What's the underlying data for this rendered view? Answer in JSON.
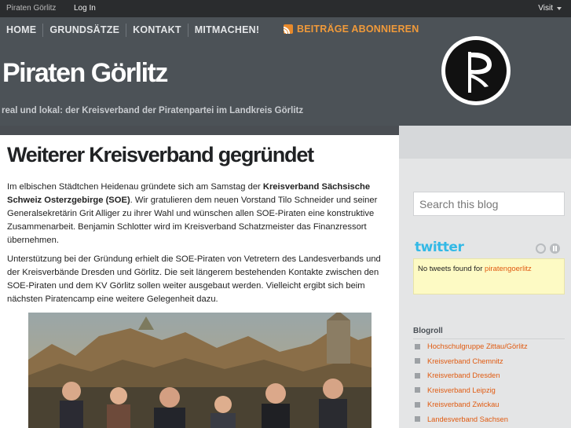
{
  "adminbar": {
    "site_name": "Piraten Görlitz",
    "login": "Log In",
    "visit": "Visit"
  },
  "nav": {
    "items": [
      "HOME",
      "GRUNDSÄTZE",
      "KONTAKT",
      "MITMACHEN!"
    ],
    "feed_label": "BEITRÄGE ABONNIEREN"
  },
  "header": {
    "title": "Piraten Görlitz",
    "tagline": "real und lokal: der Kreisverband der Piratenpartei im Landkreis Görlitz"
  },
  "post": {
    "title": "Weiterer Kreisverband gegründet",
    "p1_a": "Im elbischen Städtchen Heidenau gründete sich am Samstag der ",
    "p1_b": "Kreisverband Sächsische Schweiz Osterzgebirge (SOE)",
    "p1_c": ". Wir gratulieren dem neuen Vorstand Tilo Schneider und seiner Generalsekretärin Grit Alliger zu ihrer Wahl und wünschen allen SOE-Piraten eine konstruktive Zusammenarbeit. Benjamin Schlotter wird im Kreisverband Schatzmeister das Finanzressort übernehmen.",
    "p2": "Unterstützung bei der Gründung erhielt die SOE-Piraten von Vetretern des Landesverbands und der Kreisverbände Dresden und Görlitz. Die seit längerem bestehenden Kontakte zwischen den SOE-Piraten und dem KV Görlitz sollen weiter ausgebaut werden. Vielleicht ergibt sich beim nächsten Piratencamp eine weitere Gelegenheit dazu."
  },
  "sidebar": {
    "search_placeholder": "Search this blog",
    "twitter_logo": "twitter",
    "twitter_message": "No tweets found for ",
    "twitter_user": "piratengoerlitz",
    "blogroll_title": "Blogroll",
    "blogroll": [
      "Hochschulgruppe Zittau/Görlitz",
      "Kreisverband Chemnitz",
      "Kreisverband Dresden",
      "Kreisverband Leipzig",
      "Kreisverband Zwickau",
      "Landesverband Sachsen"
    ]
  },
  "colors": {
    "header_bg": "#4c5257",
    "accent_orange": "#e05a10",
    "feed_orange": "#f09a3a",
    "twitter_blue": "#33b9e6"
  }
}
